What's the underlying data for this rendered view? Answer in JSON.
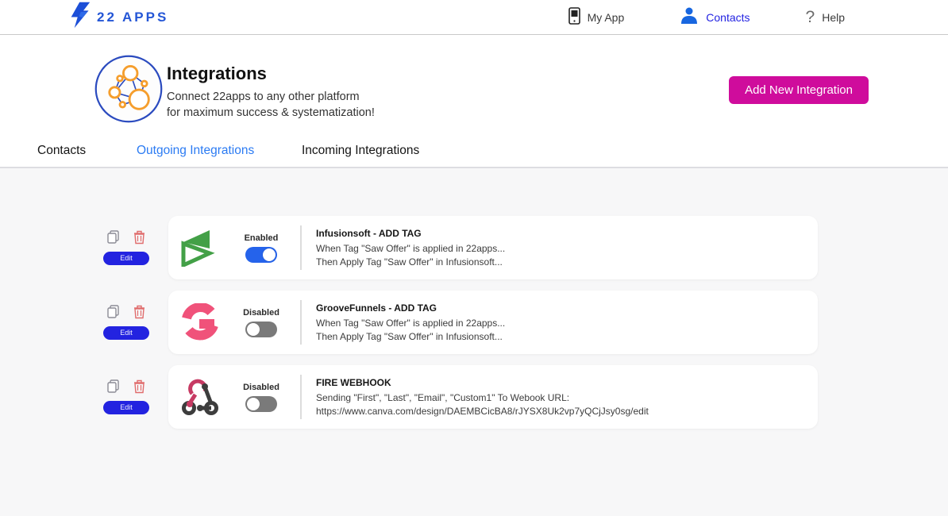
{
  "header": {
    "logo_text": "22 APPS",
    "nav": [
      {
        "label": "My App",
        "icon": "phone-icon"
      },
      {
        "label": "Contacts",
        "icon": "person-icon",
        "active": true
      },
      {
        "label": "Help",
        "icon": "question-icon",
        "glyph": "?"
      }
    ]
  },
  "hero": {
    "title": "Integrations",
    "subtitle_line1": "Connect 22apps to any other platform",
    "subtitle_line2": "for maximum success & systematization!",
    "add_button_label": "Add New Integration"
  },
  "tabs": [
    {
      "label": "Contacts",
      "active": false
    },
    {
      "label": "Outgoing Integrations",
      "active": true
    },
    {
      "label": "Incoming Integrations",
      "active": false
    }
  ],
  "cards": [
    {
      "logo": "infusionsoft-logo",
      "status_label": "Enabled",
      "enabled": true,
      "title": "Infusionsoft - ADD TAG",
      "line1": "When Tag \"Saw Offer\" is applied in 22apps...",
      "line2": "Then Apply Tag \"Saw Offer\" in Infusionsoft...",
      "edit_label": "Edit"
    },
    {
      "logo": "groovefunnels-logo",
      "status_label": "Disabled",
      "enabled": false,
      "title": "GrooveFunnels - ADD TAG",
      "line1": "When Tag \"Saw Offer\" is applied in 22apps...",
      "line2": "Then Apply Tag \"Saw Offer\" in Infusionsoft...",
      "edit_label": "Edit"
    },
    {
      "logo": "webhook-logo",
      "status_label": "Disabled",
      "enabled": false,
      "title": "FIRE WEBHOOK",
      "line1": "Sending \"First\", \"Last\", \"Email\", \"Custom1\" To Webook URL:",
      "line2": "https://www.canva.com/design/DAEMBCicBA8/rJYSX8Uk2vp7yQCjJsy0sg/edit",
      "edit_label": "Edit"
    }
  ],
  "colors": {
    "brand_blue": "#2456d6",
    "nav_active_blue": "#2323e2",
    "add_button_magenta": "#cf0c9c",
    "tab_active_blue": "#2b7bf3",
    "toggle_on_blue": "#2563eb",
    "toggle_off_grey": "#7a7a7a",
    "edit_button_blue": "#2323e0",
    "trash_red": "#e06c6c",
    "infusionsoft_green": "#43a047",
    "groovefunnels_pink": "#f0527a",
    "webhook_dark": "#3d3d3d",
    "webhook_crimson": "#c73a63",
    "content_bg": "#f7f7f8"
  }
}
